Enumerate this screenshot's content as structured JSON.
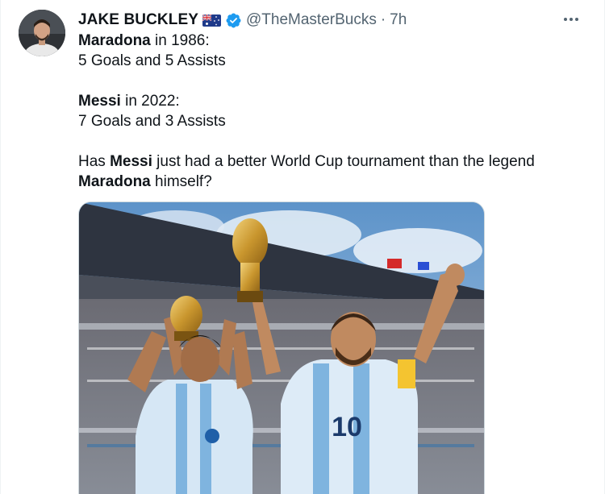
{
  "author": {
    "display_name": "JAKE BUCKLEY",
    "handle": "@TheMasterBucks",
    "time": "7h",
    "flag_icon": "australia-flag-icon",
    "verified_icon": "verified-badge-icon"
  },
  "colors": {
    "text_primary": "#0f1419",
    "text_secondary": "#536471",
    "verified_blue": "#1d9bf0"
  },
  "tweet": {
    "line1_bold": "Maradona",
    "line1_rest": " in 1986:",
    "line2": "5 Goals and 5 Assists",
    "line3_bold": "Messi",
    "line3_rest": " in 2022:",
    "line4": "7 Goals and 3 Assists",
    "line5_pre": "Has ",
    "line5_bold": "Messi",
    "line5_rest": " just had a better World Cup tournament than the legend",
    "line6_bold": "Maradona",
    "line6_rest": " himself?"
  },
  "media": {
    "icon": "photo-icon",
    "jersey_number": "10"
  },
  "menu": {
    "more_icon": "more-horizontal-icon"
  }
}
